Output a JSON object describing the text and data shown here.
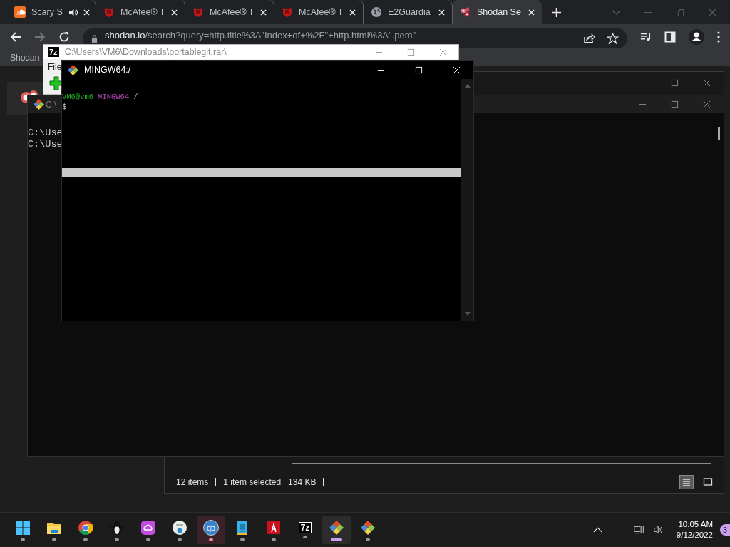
{
  "browser": {
    "tabs": [
      {
        "kind": "soundcloud",
        "title": "Scary S",
        "audio": true,
        "selected": false
      },
      {
        "kind": "mcafee",
        "title": "McAfee® T",
        "audio": false,
        "selected": false
      },
      {
        "kind": "mcafee",
        "title": "McAfee® T",
        "audio": false,
        "selected": false
      },
      {
        "kind": "mcafee",
        "title": "McAfee® T",
        "audio": false,
        "selected": false
      },
      {
        "kind": "globe",
        "title": "E2Guardia",
        "audio": false,
        "selected": false
      },
      {
        "kind": "shodan",
        "title": "Shodan Se",
        "audio": false,
        "selected": true
      }
    ],
    "url_host": "shodan.io",
    "url_path": "/search?query=http.title%3A\"Index+of+%2F\"+http.html%3A\".pem\"",
    "bookmarks": [
      "Shodan"
    ]
  },
  "explorer": {
    "status": [
      "12 items",
      "1 item selected",
      "134 KB"
    ],
    "view_buttons": [
      {
        "kind": "details",
        "selected": true
      },
      {
        "kind": "tiles",
        "selected": false
      }
    ]
  },
  "cmd": {
    "title": "C:\\",
    "lines": [
      "C:\\Use",
      "C:\\Use"
    ]
  },
  "sevenzip": {
    "logo": "7z",
    "title": "C:\\Users\\VM6\\Downloads\\portablegit.rar\\",
    "menu": [
      "File"
    ]
  },
  "terminal": {
    "title": "MINGW64:/",
    "user": "VM6@vm6",
    "system": "MINGW64",
    "path": "/",
    "prompt": "$"
  },
  "taskbar": {
    "apps": [
      {
        "kind": "start",
        "selected": false,
        "attention": false
      },
      {
        "kind": "folder",
        "selected": false,
        "attention": false
      },
      {
        "kind": "chrome",
        "selected": false,
        "attention": false
      },
      {
        "kind": "penguin",
        "selected": false,
        "attention": false
      },
      {
        "kind": "creative",
        "selected": false,
        "attention": false
      },
      {
        "kind": "globe",
        "selected": false,
        "attention": false
      },
      {
        "kind": "torrent",
        "label": "qb",
        "selected": false,
        "attention": true
      },
      {
        "kind": "notepad",
        "selected": false,
        "attention": false
      },
      {
        "kind": "acrobat",
        "selected": false,
        "attention": false
      },
      {
        "kind": "archiver",
        "label": "7z",
        "selected": false,
        "attention": false
      },
      {
        "kind": "git",
        "selected": true,
        "attention": false
      },
      {
        "kind": "git",
        "selected": false,
        "attention": false
      }
    ],
    "time": "10:05 AM",
    "date": "9/12/2022",
    "badge": "3"
  }
}
